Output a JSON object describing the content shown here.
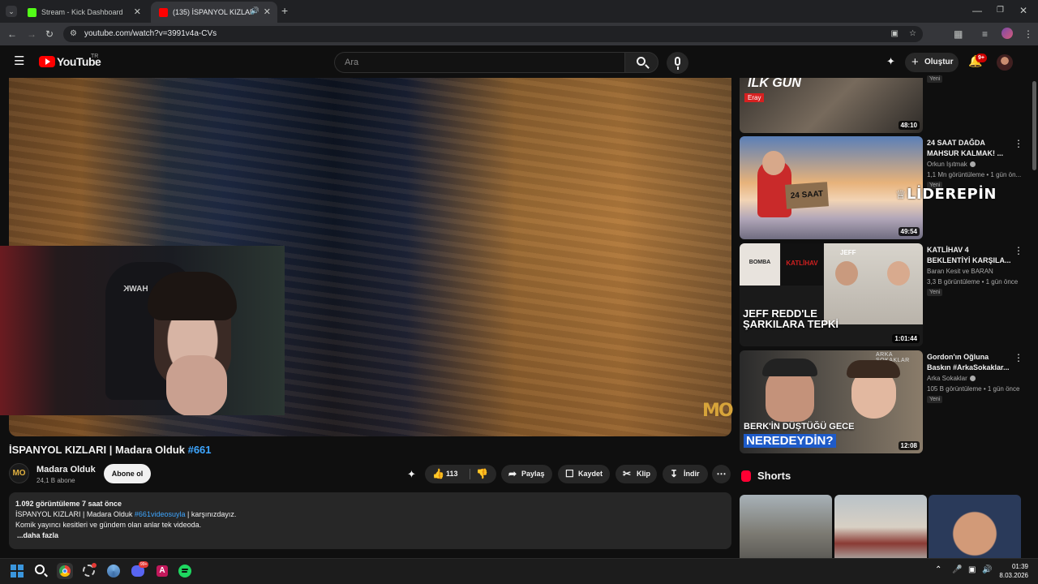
{
  "browser": {
    "tabs": [
      {
        "label": "Stream - Kick Dashboard",
        "favicon_color": "#53fc18"
      },
      {
        "label": "(135) İSPANYOL KIZLARI | M",
        "favicon_color": "#ff0000"
      }
    ],
    "url": "youtube.com/watch?v=3991v4a-CVs",
    "new_tab": "+"
  },
  "youtube": {
    "logo": "YouTube",
    "country": "TR",
    "search_placeholder": "Ara",
    "create_label": "Oluştur",
    "notifications": "9+"
  },
  "video": {
    "title": "İSPANYOL KIZLARI | Madara Olduk",
    "hashtag": "#661",
    "watermark": "MO",
    "channel": {
      "name": "Madara Olduk",
      "subscribers": "24,1 B abone",
      "avatar": "MO"
    },
    "subscribe_label": "Abone ol",
    "actions": {
      "likes": "113",
      "share": "Paylaş",
      "save": "Kaydet",
      "clip": "Klip",
      "download": "İndir"
    },
    "description": {
      "stats": "1.092 görüntüleme  7 saat önce",
      "line1_text": "İSPANYOL KIZLARI | Madara Olduk",
      "line1_link": "#661videosuyla",
      "line1_tail": "karşınızdayız.",
      "line2": "Komik yayıncı kesitleri ve gündem olan anlar tek videoda.",
      "more": "...daha fazla"
    }
  },
  "sidebar": {
    "partial_card": {
      "thumb_text": "İLK GÜN",
      "thumb_tag": "Eray",
      "duration": "48:10",
      "new": "Yeni"
    },
    "cards": [
      {
        "title": "24 SAAT DAĞDA MAHSUR KALMAK! ...",
        "channel": "Orkun Işıtmak",
        "meta": "1,1 Mn görüntüleme • 1 gün ön...",
        "new": "Yeni",
        "duration": "49:54",
        "thumb_sign": "24 SAAT"
      },
      {
        "title": "KATLİHAV 4 BEKLENTİYİ KARŞILA...",
        "channel": "Baran Kesit ve BARAN",
        "meta": "3,3 B görüntüleme • 1 gün önce",
        "new": "Yeni",
        "duration": "1:01:44",
        "thumb_text": "JEFF REDD'LE ŞARKILARA TEPKİ",
        "thumb_label": "JEFF",
        "thumb_small1": "BOMBA",
        "thumb_small2": "KATLİHAV"
      },
      {
        "title": "Gordon'ın Oğluna Baskın #ArkaSokaklar...",
        "channel": "Arka Sokaklar",
        "meta": "105 B görüntüleme • 1 gün önce",
        "new": "Yeni",
        "duration": "12:08",
        "thumb_text1": "BERK'İN DÜŞTÜĞÜ GECE",
        "thumb_text2": "NEREDEYDİN?",
        "thumb_label": "ARKA SOKAKLAR"
      }
    ],
    "overlay_logo": "LİDEREPİN",
    "shorts_label": "Shorts"
  },
  "taskbar": {
    "time": "01:39",
    "date": "8.03.2026",
    "chrome_badge": "",
    "discord_badge": "99+"
  }
}
